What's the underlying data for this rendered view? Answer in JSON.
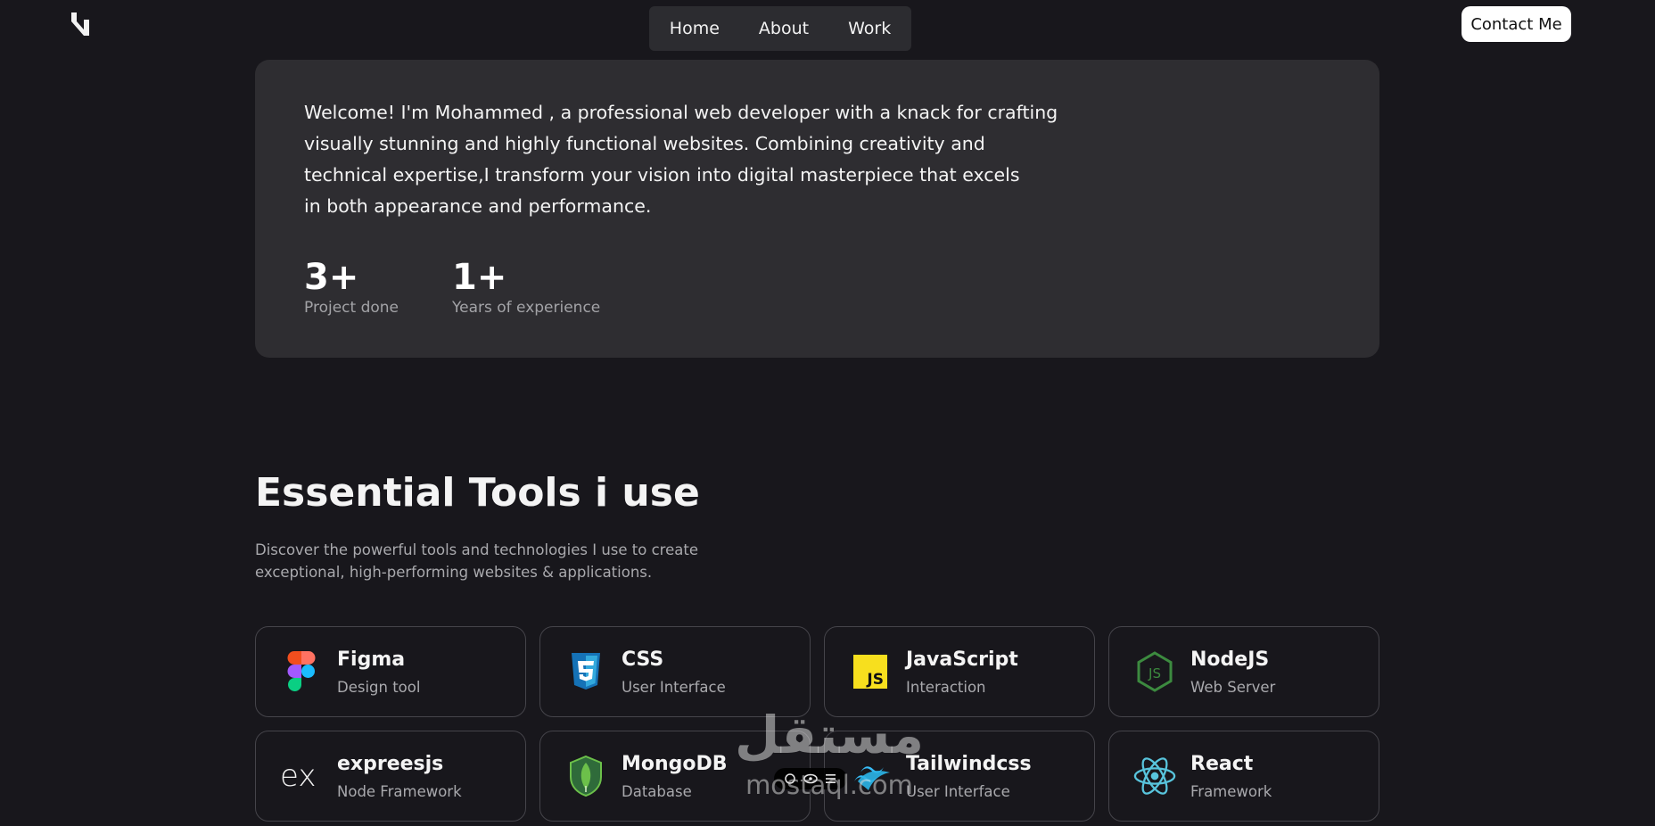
{
  "header": {
    "logo_icon": "brand-logo-icon",
    "nav": [
      {
        "label": "Home"
      },
      {
        "label": "About"
      },
      {
        "label": "Work"
      }
    ],
    "contact_label": "Contact Me"
  },
  "hero": {
    "lines": [
      "Welcome! I'm Mohammed , a professional web developer with a knack for crafting",
      "visually stunning and highly functional websites. Combining creativity and",
      "technical expertise,I transform your vision into digital masterpiece that excels",
      "in both appearance and performance."
    ],
    "stats": [
      {
        "value": "3+",
        "label": "Project done"
      },
      {
        "value": "1+",
        "label": "Years of experience"
      }
    ]
  },
  "tools": {
    "title": "Essential Tools i use",
    "desc_lines": [
      "Discover the powerful tools and technologies I use to create",
      "exceptional, high-performing websites & applications."
    ],
    "items": [
      {
        "name": "Figma",
        "sub": "Design tool",
        "icon": "figma-icon"
      },
      {
        "name": "CSS",
        "sub": "User Interface",
        "icon": "css3-icon"
      },
      {
        "name": "JavaScript",
        "sub": "Interaction",
        "icon": "javascript-icon"
      },
      {
        "name": "NodeJS",
        "sub": "Web Server",
        "icon": "nodejs-icon"
      },
      {
        "name": "expreesjs",
        "sub": "Node Framework",
        "icon": "expressjs-icon"
      },
      {
        "name": "MongoDB",
        "sub": "Database",
        "icon": "mongodb-icon"
      },
      {
        "name": "Tailwindcss",
        "sub": "User Interface",
        "icon": "tailwind-icon"
      },
      {
        "name": "React",
        "sub": "Framework",
        "icon": "react-icon"
      }
    ]
  },
  "watermark": {
    "arabic": "مستقل",
    "latin": "mostaql.com"
  },
  "colors": {
    "background": "#18171c",
    "card": "#2e2d31",
    "nav": "#2c2c30"
  }
}
